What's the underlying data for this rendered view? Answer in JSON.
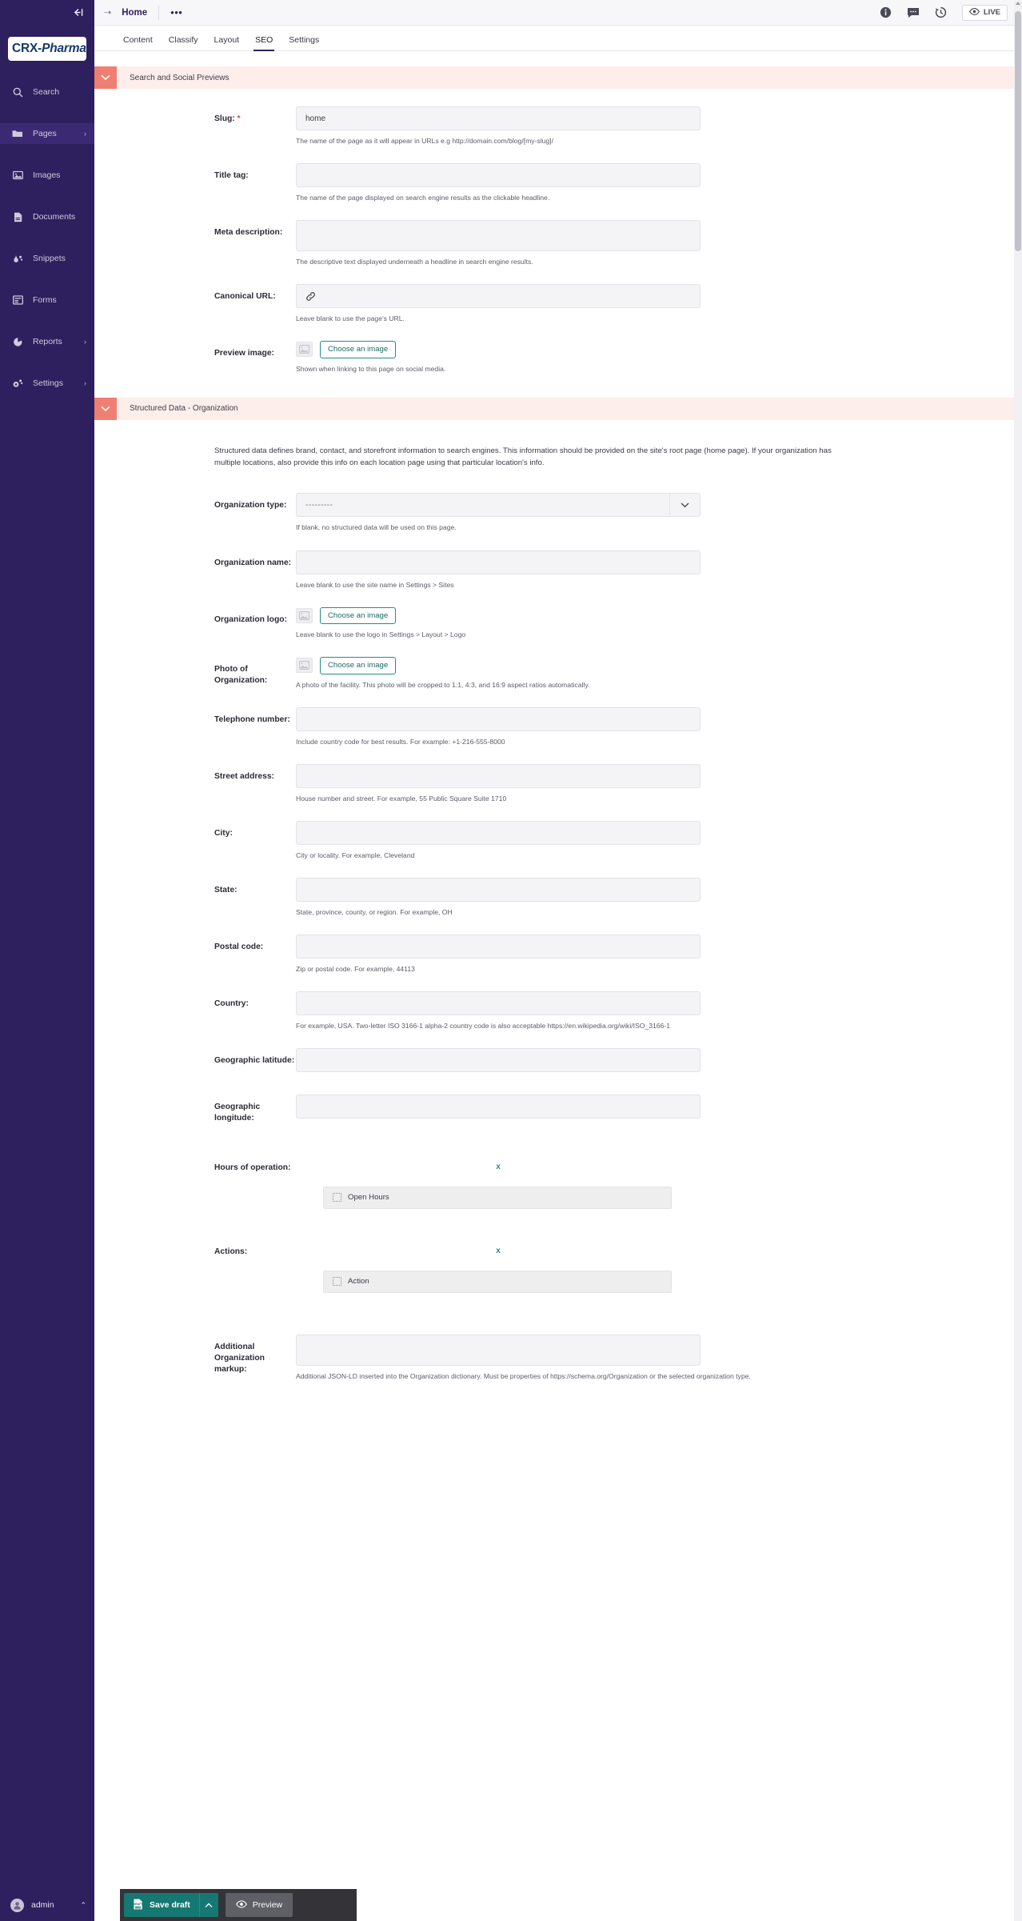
{
  "sidebar": {
    "collapse_icon": "collapse-arrow-icon",
    "logo": {
      "text_bold": "CRX-",
      "text_italic": "Pharma"
    },
    "items": [
      {
        "label": "Search",
        "icon": "search-icon",
        "has_chevron": false,
        "active": false
      },
      {
        "label": "Pages",
        "icon": "folder-icon",
        "has_chevron": true,
        "active": true
      },
      {
        "label": "Images",
        "icon": "image-icon",
        "has_chevron": false,
        "active": false
      },
      {
        "label": "Documents",
        "icon": "document-icon",
        "has_chevron": false,
        "active": false
      },
      {
        "label": "Snippets",
        "icon": "snippets-icon",
        "has_chevron": false,
        "active": false
      },
      {
        "label": "Forms",
        "icon": "forms-icon",
        "has_chevron": false,
        "active": false
      },
      {
        "label": "Reports",
        "icon": "reports-icon",
        "has_chevron": true,
        "active": false
      },
      {
        "label": "Settings",
        "icon": "gear-icon",
        "has_chevron": true,
        "active": false
      }
    ],
    "chevron": "›",
    "user": {
      "name": "admin",
      "chevron": "⌃",
      "avatar": "avatar-icon"
    }
  },
  "topbar": {
    "breadcrumb_arrow": "⇢",
    "title": "Home",
    "more_dots": "•••",
    "icons": [
      "info-icon",
      "comment-icon",
      "history-icon"
    ],
    "live_label": "LIVE"
  },
  "tabs": [
    {
      "label": "Content",
      "active": false
    },
    {
      "label": "Classify",
      "active": false
    },
    {
      "label": "Layout",
      "active": false
    },
    {
      "label": "SEO",
      "active": true
    },
    {
      "label": "Settings",
      "active": false
    }
  ],
  "sections": {
    "search_social": {
      "title": "Search and Social Previews",
      "toggle_icon": "chevron-down-icon",
      "fields": {
        "slug": {
          "label": "Slug:",
          "required_marker": "*",
          "value": "home",
          "help": "The name of the page as it will appear in URLs e.g http://domain.com/blog/[my-slug]/"
        },
        "title_tag": {
          "label": "Title tag:",
          "value": "",
          "help": "The name of the page displayed on search engine results as the clickable headline."
        },
        "meta_description": {
          "label": "Meta description:",
          "value": "",
          "help": "The descriptive text displayed underneath a headline in search engine results."
        },
        "canonical_url": {
          "label": "Canonical URL:",
          "value": "",
          "icon": "link-icon",
          "help": "Leave blank to use the page's URL."
        },
        "preview_image": {
          "label": "Preview image:",
          "button": "Choose an image",
          "thumb_icon": "image-placeholder-icon",
          "help": "Shown when linking to this page on social media."
        }
      }
    },
    "structured_data": {
      "title": "Structured Data - Organization",
      "toggle_icon": "chevron-down-icon",
      "intro": "Structured data defines brand, contact, and storefront information to search engines. This information should be provided on the site's root page (home page). If your organization has multiple locations, also provide this info on each location page using that particular location's info.",
      "fields": {
        "organization_type": {
          "label": "Organization type:",
          "value": "---------",
          "arrow_icon": "chevron-down-icon",
          "help": "If blank, no structured data will be used on this page."
        },
        "organization_name": {
          "label": "Organization name:",
          "value": "",
          "help": "Leave blank to use the site name in Settings > Sites"
        },
        "organization_logo": {
          "label": "Organization logo:",
          "button": "Choose an image",
          "thumb_icon": "image-placeholder-icon",
          "help": "Leave blank to use the logo in Settings > Layout > Logo"
        },
        "photo_of_organization": {
          "label": "Photo of Organization:",
          "button": "Choose an image",
          "thumb_icon": "image-placeholder-icon",
          "help": "A photo of the facility. This photo will be cropped to 1:1, 4:3, and 16:9 aspect ratios automatically."
        },
        "telephone_number": {
          "label": "Telephone number:",
          "value": "",
          "help": "Include country code for best results. For example: +1-216-555-8000"
        },
        "street_address": {
          "label": "Street address:",
          "value": "",
          "help": "House number and street. For example, 55 Public Square Suite 1710"
        },
        "city": {
          "label": "City:",
          "value": "",
          "help": "City or locality. For example, Cleveland"
        },
        "state": {
          "label": "State:",
          "value": "",
          "help": "State, province, county, or region. For example, OH"
        },
        "postal_code": {
          "label": "Postal code:",
          "value": "",
          "help": "Zip or postal code. For example, 44113"
        },
        "country": {
          "label": "Country:",
          "value": "",
          "help": "For example, USA. Two-letter ISO 3166-1 alpha-2 country code is also acceptable https://en.wikipedia.org/wiki/ISO_3166-1"
        },
        "geographic_latitude": {
          "label": "Geographic latitude:",
          "value": "",
          "help": ""
        },
        "geographic_longitude": {
          "label": "Geographic longitude:",
          "value": "",
          "help": ""
        },
        "hours_of_operation": {
          "label": "Hours of operation:",
          "remove_label": "x",
          "block_label": "Open Hours",
          "grip_icon": "drag-handle-icon"
        },
        "actions": {
          "label": "Actions:",
          "remove_label": "x",
          "block_label": "Action",
          "grip_icon": "drag-handle-icon"
        },
        "additional_markup": {
          "label": "Additional Organization markup:",
          "value": "",
          "help": "Additional JSON-LD inserted into the Organization dictionary. Must be properties of https://schema.org/Organization or the selected organization type."
        }
      }
    }
  },
  "action_bar": {
    "save_label": "Save draft",
    "save_icon": "draft-icon",
    "save_arrow": "⌃",
    "preview_label": "Preview",
    "preview_icon": "eye-icon"
  }
}
